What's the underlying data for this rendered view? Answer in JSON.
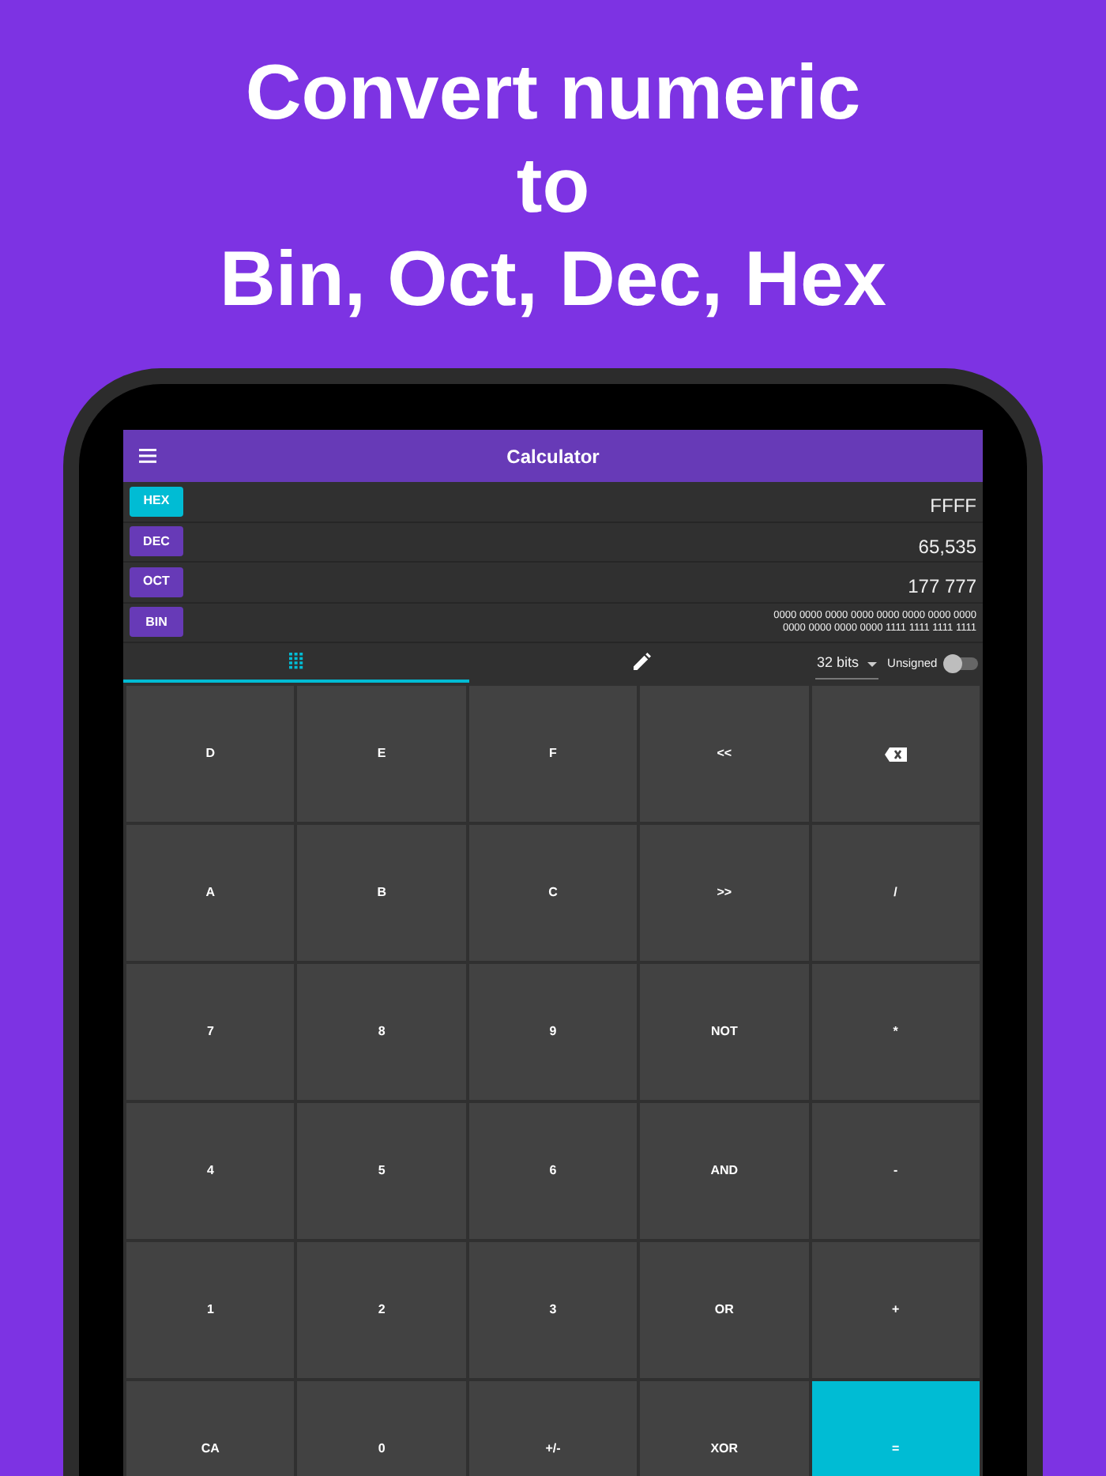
{
  "headline": [
    "Convert numeric",
    "to",
    "Bin, Oct, Dec, Hex"
  ],
  "app_bar": {
    "title": "Calculator"
  },
  "bases": [
    {
      "label": "HEX",
      "value": "FFFF",
      "selected": true
    },
    {
      "label": "DEC",
      "value": "65,535",
      "selected": false
    },
    {
      "label": "OCT",
      "value": "177 777",
      "selected": false
    },
    {
      "label": "BIN",
      "value_lines": [
        "0000 0000 0000 0000 0000 0000 0000 0000",
        "0000 0000 0000 0000 1111 1111 1111 1111"
      ],
      "selected": false
    }
  ],
  "tabs": [
    {
      "kind": "keypad",
      "selected": true
    },
    {
      "kind": "edit",
      "selected": false
    }
  ],
  "bits_dropdown": "32 bits",
  "unsigned": {
    "label": "Unsigned",
    "on": false
  },
  "keys": [
    {
      "kind": "text",
      "label": "D",
      "highlighted": false
    },
    {
      "kind": "text",
      "label": "E",
      "highlighted": false
    },
    {
      "kind": "text",
      "label": "F",
      "highlighted": false
    },
    {
      "kind": "text",
      "label": "<<",
      "highlighted": false
    },
    {
      "kind": "backspace",
      "highlighted": false
    },
    {
      "kind": "text",
      "label": "A",
      "highlighted": false
    },
    {
      "kind": "text",
      "label": "B",
      "highlighted": false
    },
    {
      "kind": "text",
      "label": "C",
      "highlighted": false
    },
    {
      "kind": "text",
      "label": ">>",
      "highlighted": false
    },
    {
      "kind": "text",
      "label": "/",
      "highlighted": false
    },
    {
      "kind": "text",
      "label": "7",
      "highlighted": false
    },
    {
      "kind": "text",
      "label": "8",
      "highlighted": false
    },
    {
      "kind": "text",
      "label": "9",
      "highlighted": false
    },
    {
      "kind": "text",
      "label": "NOT",
      "highlighted": false
    },
    {
      "kind": "text",
      "label": "*",
      "highlighted": false
    },
    {
      "kind": "text",
      "label": "4",
      "highlighted": false
    },
    {
      "kind": "text",
      "label": "5",
      "highlighted": false
    },
    {
      "kind": "text",
      "label": "6",
      "highlighted": false
    },
    {
      "kind": "text",
      "label": "AND",
      "highlighted": false
    },
    {
      "kind": "text",
      "label": "-",
      "highlighted": false
    },
    {
      "kind": "text",
      "label": "1",
      "highlighted": false
    },
    {
      "kind": "text",
      "label": "2",
      "highlighted": false
    },
    {
      "kind": "text",
      "label": "3",
      "highlighted": false
    },
    {
      "kind": "text",
      "label": "OR",
      "highlighted": false
    },
    {
      "kind": "text",
      "label": "+",
      "highlighted": false
    },
    {
      "kind": "text",
      "label": "CA",
      "highlighted": false
    },
    {
      "kind": "text",
      "label": "0",
      "highlighted": false
    },
    {
      "kind": "text",
      "label": "+/-",
      "highlighted": false
    },
    {
      "kind": "text",
      "label": "XOR",
      "highlighted": false
    },
    {
      "kind": "text",
      "label": "=",
      "highlighted": true
    }
  ]
}
